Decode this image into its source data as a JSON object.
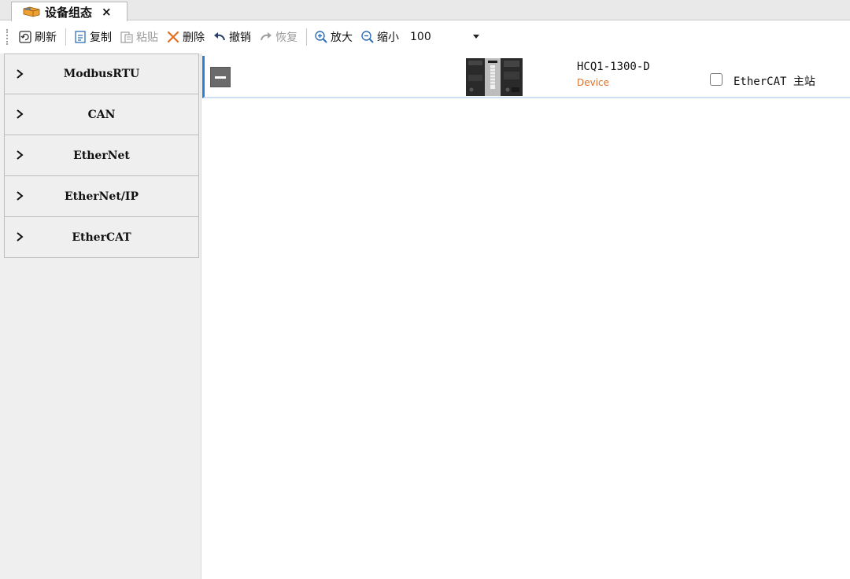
{
  "tab": {
    "title": "设备组态",
    "close": "×"
  },
  "toolbar": {
    "refresh": "刷新",
    "copy": "复制",
    "paste": "粘贴",
    "delete": "删除",
    "undo": "撤销",
    "redo": "恢复",
    "zoom_in": "放大",
    "zoom_out": "缩小",
    "zoom_value": "100"
  },
  "sidebar": {
    "items": [
      {
        "label": "ModbusRTU"
      },
      {
        "label": "CAN"
      },
      {
        "label": "EtherNet"
      },
      {
        "label": "EtherNet/IP"
      },
      {
        "label": "EtherCAT"
      }
    ]
  },
  "device": {
    "name": "HCQ1-1300-D",
    "type": "Device",
    "ethercat_master_label": "EtherCAT 主站",
    "ethercat_master_checked": false
  },
  "colors": {
    "accent": "#2f7fd0",
    "device_type": "#d9722a",
    "delete_icon": "#e07020"
  }
}
